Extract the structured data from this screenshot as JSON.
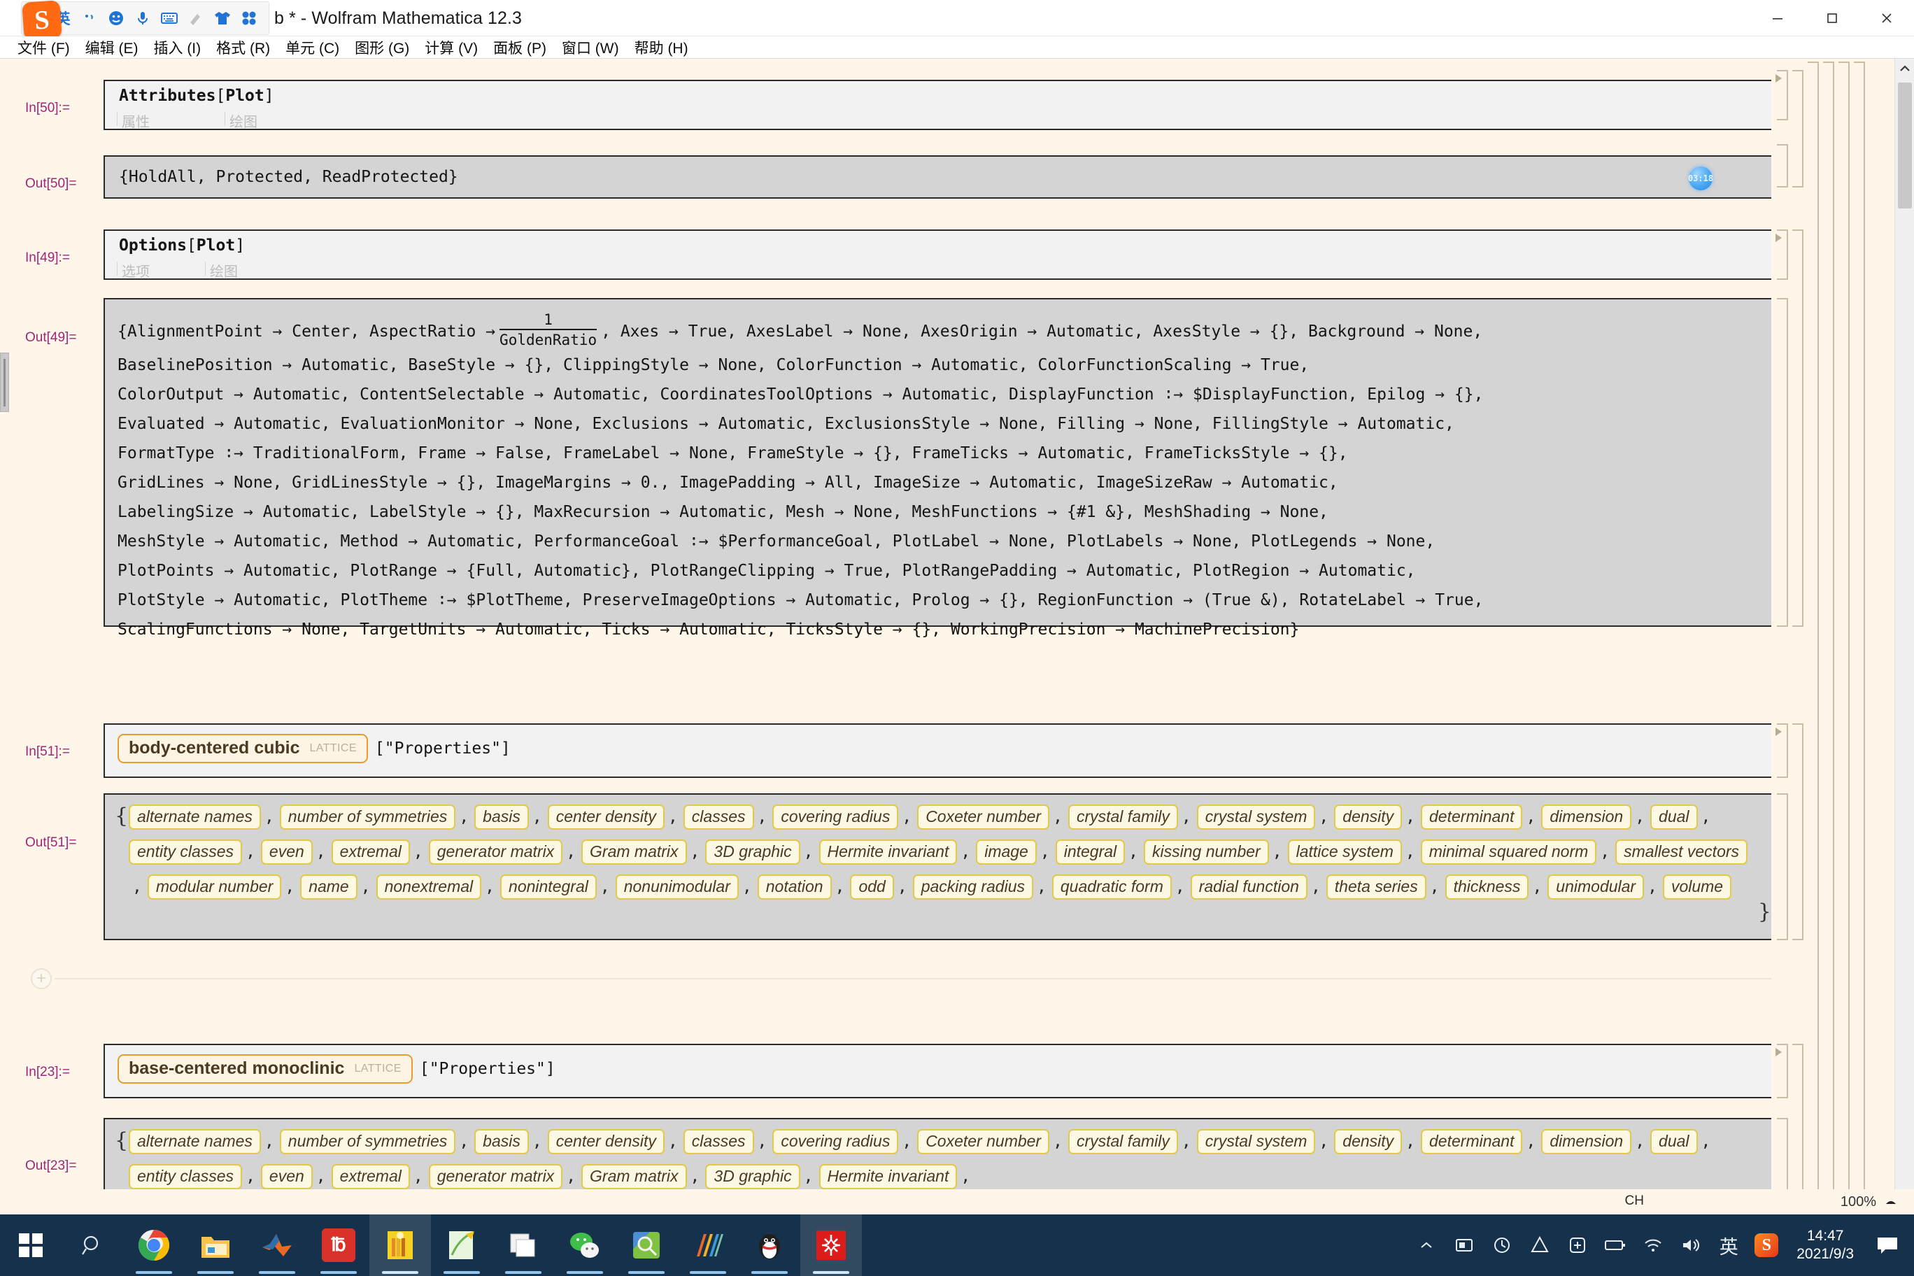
{
  "window": {
    "title": "b * - Wolfram Mathematica 12.3",
    "minimize_label": "Minimize",
    "maximize_label": "Maximize",
    "close_label": "Close"
  },
  "ime": {
    "name": "Sogou Pinyin",
    "logo_text": "S",
    "mode_label": "英",
    "buttons": [
      {
        "name": "ime-mode-chinese-english",
        "glyph": "英"
      },
      {
        "name": "ime-punctuation",
        "glyph": "·,"
      },
      {
        "name": "ime-emoji",
        "glyph": "☺"
      },
      {
        "name": "ime-voice-input",
        "glyph": "🎤"
      },
      {
        "name": "ime-soft-keyboard",
        "glyph": "⌨"
      },
      {
        "name": "ime-handwriting",
        "glyph": "✍"
      },
      {
        "name": "ime-skin",
        "glyph": "👕"
      },
      {
        "name": "ime-toolbox",
        "glyph": "▦"
      }
    ]
  },
  "menubar": {
    "items": [
      {
        "label": "文件 (F)",
        "name": "menu-file"
      },
      {
        "label": "编辑 (E)",
        "name": "menu-edit"
      },
      {
        "label": "插入 (I)",
        "name": "menu-insert"
      },
      {
        "label": "格式 (R)",
        "name": "menu-format"
      },
      {
        "label": "单元 (C)",
        "name": "menu-cell"
      },
      {
        "label": "图形 (G)",
        "name": "menu-graphics"
      },
      {
        "label": "计算 (V)",
        "name": "menu-evaluation"
      },
      {
        "label": "面板 (P)",
        "name": "menu-palettes"
      },
      {
        "label": "窗口 (W)",
        "name": "menu-window"
      },
      {
        "label": "帮助 (H)",
        "name": "menu-help"
      }
    ]
  },
  "notebook": {
    "zoom_level": "100%",
    "cells": {
      "attributes": {
        "in_label": "In[50]:=",
        "out_label": "Out[50]=",
        "input_head": "Attributes",
        "input_open": "[",
        "input_arg": "Plot",
        "input_close": "]",
        "hint_head": "属性",
        "hint_arg": "绘图",
        "output": "{HoldAll, Protected, ReadProtected}",
        "timestamp_badge": "03:18"
      },
      "options": {
        "in_label": "In[49]:=",
        "out_label": "Out[49]=",
        "input_head": "Options",
        "input_open": "[",
        "input_arg": "Plot",
        "input_close": "]",
        "hint_head": "选项",
        "hint_arg": "绘图",
        "fraction_numerator": "1",
        "fraction_denominator": "GoldenRatio",
        "line1_a": "{AlignmentPoint → Center, AspectRatio →",
        "line1_b": ", Axes → True, AxesLabel → None, AxesOrigin → Automatic, AxesStyle → {}, Background → None,",
        "lines": [
          "BaselinePosition → Automatic, BaseStyle → {}, ClippingStyle → None, ColorFunction → Automatic, ColorFunctionScaling → True,",
          "ColorOutput → Automatic, ContentSelectable → Automatic, CoordinatesToolOptions → Automatic, DisplayFunction ∶→ $DisplayFunction, Epilog → {},",
          "Evaluated → Automatic, EvaluationMonitor → None, Exclusions → Automatic, ExclusionsStyle → None, Filling → None, FillingStyle → Automatic,",
          "FormatType ∶→ TraditionalForm, Frame → False, FrameLabel → None, FrameStyle → {}, FrameTicks → Automatic, FrameTicksStyle → {},",
          "GridLines → None, GridLinesStyle → {}, ImageMargins → 0., ImagePadding → All, ImageSize → Automatic, ImageSizeRaw → Automatic,",
          "LabelingSize → Automatic, LabelStyle → {}, MaxRecursion → Automatic, Mesh → None, MeshFunctions → {#1 &}, MeshShading → None,",
          "MeshStyle → Automatic, Method → Automatic, PerformanceGoal ∶→ $PerformanceGoal, PlotLabel → None, PlotLabels → None, PlotLegends → None,",
          "PlotPoints → Automatic, PlotRange → {Full, Automatic}, PlotRangeClipping → True, PlotRangePadding → Automatic, PlotRegion → Automatic,",
          "PlotStyle → Automatic, PlotTheme ∶→ $PlotTheme, PreserveImageOptions → Automatic, Prolog → {}, RegionFunction → (True &), RotateLabel → True,",
          "ScalingFunctions → None, TargetUnits → Automatic, Ticks → Automatic, TicksStyle → {}, WorkingPrecision → MachinePrecision}"
        ]
      },
      "lattice1": {
        "in_label": "In[51]:=",
        "out_label": "Out[51]=",
        "entity_name": "body-centered cubic",
        "entity_type": "LATTICE",
        "call_suffix": "[\"Properties\"]",
        "open_brace": "{",
        "close_brace": "}",
        "properties": [
          "alternate names",
          "number of symmetries",
          "basis",
          "center density",
          "classes",
          "covering radius",
          "Coxeter number",
          "crystal family",
          "crystal system",
          "density",
          "determinant",
          "dimension",
          "dual",
          "entity classes",
          "even",
          "extremal",
          "generator matrix",
          "Gram matrix",
          "3D graphic",
          "Hermite invariant",
          "image",
          "integral",
          "kissing number",
          "lattice system",
          "minimal squared norm",
          "smallest vectors",
          "modular number",
          "name",
          "nonextremal",
          "nonintegral",
          "nonunimodular",
          "notation",
          "odd",
          "packing radius",
          "quadratic form",
          "radial function",
          "theta series",
          "thickness",
          "unimodular",
          "volume"
        ]
      },
      "lattice2": {
        "in_label": "In[23]:=",
        "out_label": "Out[23]=",
        "entity_name": "base-centered monoclinic",
        "entity_type": "LATTICE",
        "call_suffix": "[\"Properties\"]",
        "open_brace": "{",
        "properties": [
          "alternate names",
          "number of symmetries",
          "basis",
          "center density",
          "classes",
          "covering radius",
          "Coxeter number",
          "crystal family",
          "crystal system",
          "density",
          "determinant",
          "dimension",
          "dual",
          "entity classes",
          "even",
          "extremal",
          "generator matrix",
          "Gram matrix",
          "3D graphic",
          "Hermite invariant"
        ]
      }
    }
  },
  "taskbar": {
    "apps": [
      {
        "name": "start-button",
        "label": "Start"
      },
      {
        "name": "search-button",
        "label": "Search"
      },
      {
        "name": "taskbar-chrome",
        "label": "Google Chrome"
      },
      {
        "name": "taskbar-file-explorer",
        "label": "File Explorer"
      },
      {
        "name": "taskbar-matlab",
        "label": "MATLAB"
      },
      {
        "name": "taskbar-pdf-reader",
        "label": "PDF Reader"
      },
      {
        "name": "taskbar-notes",
        "label": "Notes"
      },
      {
        "name": "taskbar-editor",
        "label": "Editor"
      },
      {
        "name": "taskbar-windows-explorer",
        "label": "Explorer"
      },
      {
        "name": "taskbar-wechat",
        "label": "WeChat"
      },
      {
        "name": "taskbar-everything",
        "label": "Everything"
      },
      {
        "name": "taskbar-origin",
        "label": "Origin"
      },
      {
        "name": "taskbar-qq",
        "label": "QQ"
      },
      {
        "name": "taskbar-mathematica",
        "label": "Wolfram Mathematica"
      }
    ],
    "tray": [
      {
        "name": "tray-battery",
        "glyph": "battery"
      },
      {
        "name": "tray-wifi",
        "glyph": "wifi"
      },
      {
        "name": "tray-volume",
        "glyph": "volume"
      },
      {
        "name": "tray-ime-indicator",
        "glyph": "英"
      },
      {
        "name": "tray-sogou",
        "glyph": "S"
      }
    ],
    "tray_overflow": [
      {
        "name": "tray-app-1"
      },
      {
        "name": "tray-app-2"
      },
      {
        "name": "tray-app-3"
      },
      {
        "name": "tray-app-4"
      },
      {
        "name": "tray-app-5"
      }
    ],
    "clock_time": "14:47",
    "clock_date": "2021/9/3",
    "notification_label": "Notifications",
    "language_badge": "CH"
  },
  "colors": {
    "accent": "#1f74d6",
    "taskbar": "#16314b",
    "notebook_bg": "#fdf6e9",
    "in_label": "#a0257a",
    "entity_border": "#e89c2a",
    "chip_border": "#e3c94a"
  }
}
